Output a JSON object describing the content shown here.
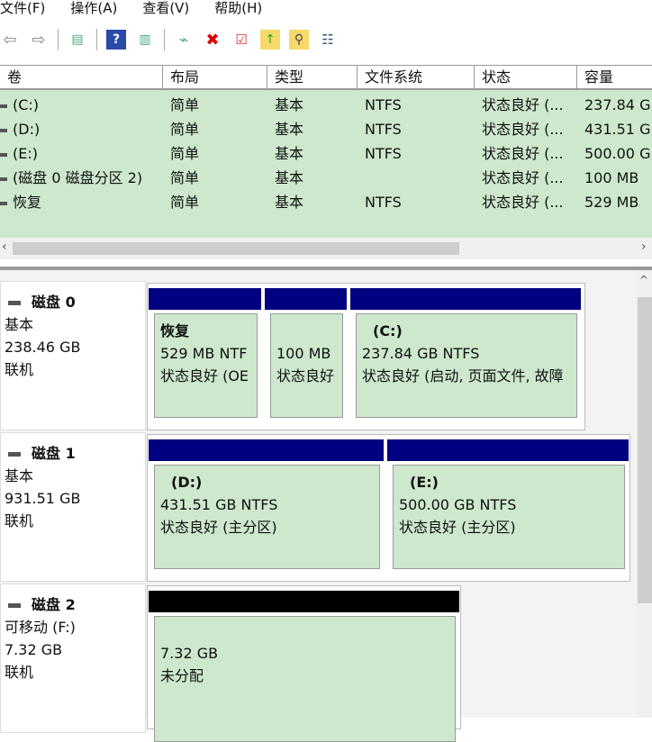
{
  "menu": [
    "文件(F)",
    "操作(A)",
    "查看(V)",
    "帮助(H)"
  ],
  "columns": [
    "卷",
    "布局",
    "类型",
    "文件系统",
    "状态",
    "容量"
  ],
  "volumes": [
    {
      "name": "(C:)",
      "layout": "简单",
      "type": "基本",
      "fs": "NTFS",
      "status": "状态良好 (...",
      "capacity": "237.84 G"
    },
    {
      "name": "(D:)",
      "layout": "简单",
      "type": "基本",
      "fs": "NTFS",
      "status": "状态良好 (...",
      "capacity": "431.51 G"
    },
    {
      "name": "(E:)",
      "layout": "简单",
      "type": "基本",
      "fs": "NTFS",
      "status": "状态良好 (...",
      "capacity": "500.00 G"
    },
    {
      "name": "(磁盘 0 磁盘分区 2)",
      "layout": "简单",
      "type": "基本",
      "fs": "",
      "status": "状态良好 (...",
      "capacity": "100 MB"
    },
    {
      "name": "恢复",
      "layout": "简单",
      "type": "基本",
      "fs": "NTFS",
      "status": "状态良好 (...",
      "capacity": "529 MB"
    }
  ],
  "disks": [
    {
      "name": "磁盘 0",
      "kind": "基本",
      "size": "238.46 GB",
      "state": "联机",
      "partitions": [
        {
          "title": "恢复",
          "size": "529 MB NTF",
          "status": "状态良好 (OE"
        },
        {
          "title": "",
          "size": "100 MB",
          "status": "状态良好"
        },
        {
          "title": "(C:)",
          "size": "237.84 GB NTFS",
          "status": "状态良好 (启动, 页面文件, 故障"
        }
      ]
    },
    {
      "name": "磁盘 1",
      "kind": "基本",
      "size": "931.51 GB",
      "state": "联机",
      "partitions": [
        {
          "title": "(D:)",
          "size": "431.51 GB NTFS",
          "status": "状态良好 (主分区)"
        },
        {
          "title": "(E:)",
          "size": "500.00 GB NTFS",
          "status": "状态良好 (主分区)"
        }
      ]
    },
    {
      "name": "磁盘 2",
      "kind": "可移动 (F:)",
      "size": "7.32 GB",
      "state": "联机",
      "partitions": [
        {
          "title": "",
          "size": "7.32 GB",
          "status": "未分配"
        }
      ]
    }
  ],
  "colors": {
    "primary": "#000080",
    "unallocated": "#000000",
    "volume_bg": "#cde8cd"
  }
}
